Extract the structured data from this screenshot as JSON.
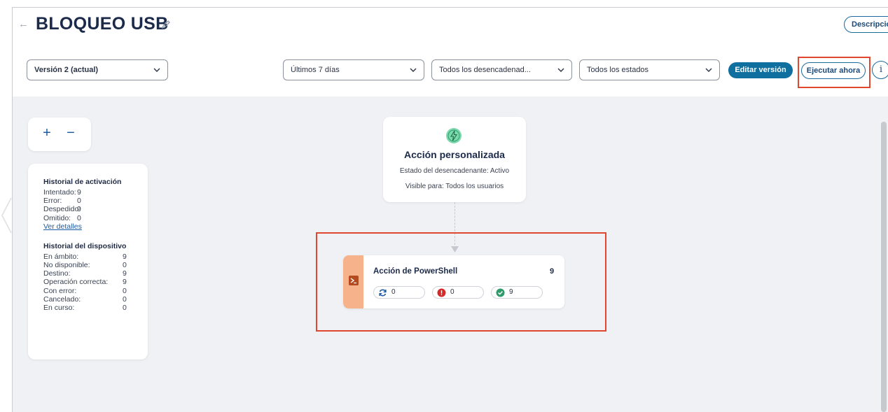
{
  "header": {
    "title": "BLOQUEO USB",
    "description_button": "Descripción"
  },
  "toolbar": {
    "version_select": "Versión 2 (actual)",
    "period_select": "Últimos 7 días",
    "trigger_select": "Todos los desencadenad...",
    "state_select": "Todos los estados",
    "edit_button": "Editar versión",
    "run_button": "Ejecutar ahora",
    "info_button": "i"
  },
  "canvas": {
    "zoom_in": "+",
    "zoom_out": "−",
    "activation_history": {
      "title": "Historial de activación",
      "rows": [
        {
          "label": "Intentado:",
          "value": "9"
        },
        {
          "label": "Error:",
          "value": "0"
        },
        {
          "label": "Despedido:",
          "value": "9"
        },
        {
          "label": "Omitido:",
          "value": "0"
        }
      ],
      "details_link": "Ver detalles"
    },
    "device_history": {
      "title": "Historial del dispositivo",
      "rows": [
        {
          "label": "En ámbito:",
          "value": "9"
        },
        {
          "label": "No disponible:",
          "value": "0"
        },
        {
          "label": "Destino:",
          "value": "9"
        },
        {
          "label": "Operación correcta:",
          "value": "9"
        },
        {
          "label": "Con error:",
          "value": "0"
        },
        {
          "label": "Cancelado:",
          "value": "0"
        },
        {
          "label": "En curso:",
          "value": "0"
        }
      ]
    },
    "trigger_node": {
      "title": "Acción personalizada",
      "state": "Estado del desencadenante: Activo",
      "visible": "Visible para: Todos los usuarios"
    },
    "action_node": {
      "title": "Acción de PowerShell",
      "count": "9",
      "retry_count": "0",
      "error_count": "0",
      "success_count": "9"
    }
  },
  "colors": {
    "accent": "#0f6f9e",
    "highlight": "#e0472e",
    "action_stripe": "#f6b28a",
    "canvas": "#eff1f4"
  }
}
